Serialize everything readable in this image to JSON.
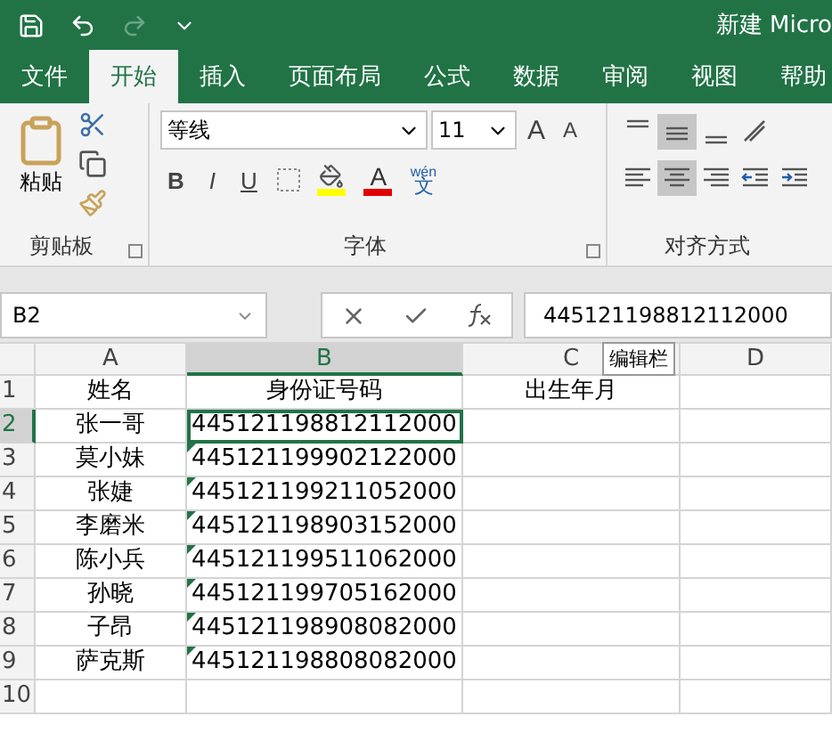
{
  "window": {
    "title": "新建 Micro"
  },
  "tabs": [
    {
      "label": "文件",
      "selected": false
    },
    {
      "label": "开始",
      "selected": true
    },
    {
      "label": "插入",
      "selected": false
    },
    {
      "label": "页面布局",
      "selected": false
    },
    {
      "label": "公式",
      "selected": false
    },
    {
      "label": "数据",
      "selected": false
    },
    {
      "label": "审阅",
      "selected": false
    },
    {
      "label": "视图",
      "selected": false
    },
    {
      "label": "帮助",
      "selected": false
    }
  ],
  "clipboard": {
    "paste_label": "粘贴",
    "group_label": "剪贴板"
  },
  "font": {
    "name": "等线",
    "size": "11",
    "grow": "A",
    "shrink": "A",
    "bold": "B",
    "italic": "I",
    "underline": "U",
    "font_color": "A",
    "phonetic_top": "wén",
    "phonetic_bottom": "文",
    "group_label": "字体"
  },
  "alignment": {
    "group_label": "对齐方式",
    "buttons": [
      {
        "kind": "top",
        "selected": false
      },
      {
        "kind": "middle",
        "selected": true
      },
      {
        "kind": "bottom",
        "selected": false
      },
      {
        "kind": "orient",
        "selected": false
      },
      {
        "kind": "left",
        "selected": false
      },
      {
        "kind": "center",
        "selected": true
      },
      {
        "kind": "right",
        "selected": false
      },
      {
        "kind": "outdent",
        "selected": false
      },
      {
        "kind": "indent",
        "selected": false
      }
    ]
  },
  "formula_bar": {
    "name_box": "B2",
    "formula": "445121198812112000",
    "tooltip": "编辑栏"
  },
  "sheet": {
    "columns": [
      {
        "label": "A",
        "selected": false
      },
      {
        "label": "B",
        "selected": true
      },
      {
        "label": "C",
        "selected": false
      },
      {
        "label": "D",
        "selected": false
      }
    ],
    "rows": [
      {
        "number": "1",
        "selected": false,
        "cells": [
          "姓名",
          "身份证号码",
          "出生年月",
          ""
        ],
        "flagged": false,
        "active": false
      },
      {
        "number": "2",
        "selected": true,
        "cells": [
          "张一哥",
          "445121198812112000",
          "",
          ""
        ],
        "flagged": false,
        "active": true
      },
      {
        "number": "3",
        "selected": false,
        "cells": [
          "莫小妹",
          "445121199902122000",
          "",
          ""
        ],
        "flagged": true,
        "active": false
      },
      {
        "number": "4",
        "selected": false,
        "cells": [
          "张婕",
          "445121199211052000",
          "",
          ""
        ],
        "flagged": true,
        "active": false
      },
      {
        "number": "5",
        "selected": false,
        "cells": [
          "李磨米",
          "445121198903152000",
          "",
          ""
        ],
        "flagged": true,
        "active": false
      },
      {
        "number": "6",
        "selected": false,
        "cells": [
          "陈小兵",
          "445121199511062000",
          "",
          ""
        ],
        "flagged": true,
        "active": false
      },
      {
        "number": "7",
        "selected": false,
        "cells": [
          "孙晓",
          "445121199705162000",
          "",
          ""
        ],
        "flagged": true,
        "active": false
      },
      {
        "number": "8",
        "selected": false,
        "cells": [
          "子昂",
          "445121198908082000",
          "",
          ""
        ],
        "flagged": true,
        "active": false
      },
      {
        "number": "9",
        "selected": false,
        "cells": [
          "萨克斯",
          "445121198808082000",
          "",
          ""
        ],
        "flagged": true,
        "active": false
      },
      {
        "number": "10",
        "selected": false,
        "cells": [
          "",
          "",
          "",
          ""
        ],
        "flagged": false,
        "active": false
      }
    ]
  }
}
